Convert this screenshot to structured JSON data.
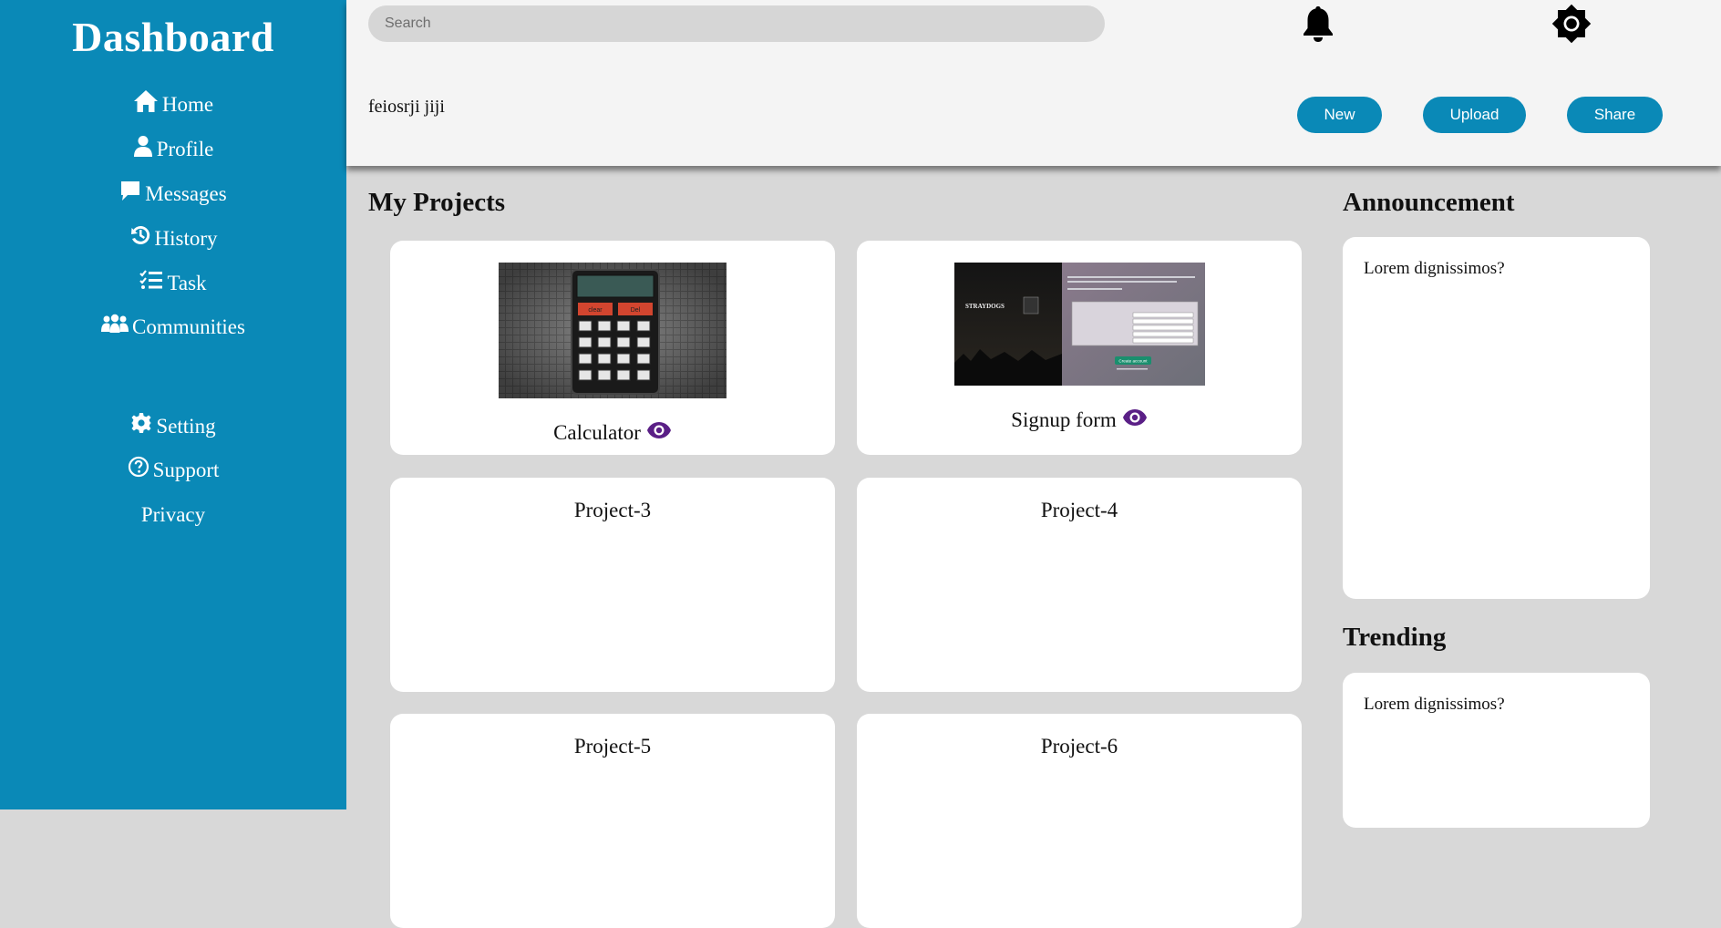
{
  "sidebar": {
    "brand": "Dashboard",
    "items": [
      {
        "label": "Home",
        "icon": "home-icon"
      },
      {
        "label": "Profile",
        "icon": "user-icon"
      },
      {
        "label": "Messages",
        "icon": "message-icon"
      },
      {
        "label": "History",
        "icon": "history-icon"
      },
      {
        "label": "Task",
        "icon": "task-list-icon"
      },
      {
        "label": "Communities",
        "icon": "users-group-icon"
      },
      {
        "label": "Setting",
        "icon": "gear-icon"
      },
      {
        "label": "Support",
        "icon": "question-circle-icon"
      },
      {
        "label": "Privacy",
        "icon": ""
      }
    ]
  },
  "header": {
    "search_placeholder": "Search",
    "username": "feiosrji jiji",
    "buttons": {
      "new": "New",
      "upload": "Upload",
      "share": "Share"
    },
    "icons": [
      "bell-icon",
      "brightness-icon"
    ]
  },
  "main": {
    "title": "My Projects",
    "projects": [
      {
        "name": "Calculator",
        "preview": "calculator"
      },
      {
        "name": "Signup form",
        "preview": "signup"
      },
      {
        "name": "Project-3"
      },
      {
        "name": "Project-4"
      },
      {
        "name": "Project-5"
      },
      {
        "name": "Project-6"
      }
    ],
    "signup_preview": {
      "brand": "STRAYDOGS",
      "button": "Create account"
    },
    "calculator_preview": {
      "clear": "clear",
      "del": "Del"
    }
  },
  "aside": {
    "announcement": {
      "title": "Announcement",
      "text": "Lorem dignissimos?"
    },
    "trending": {
      "title": "Trending",
      "text": "Lorem dignissimos?"
    }
  },
  "colors": {
    "primary": "#0a89b7",
    "eye": "#5a1f86",
    "background": "#d8d8d8",
    "header": "#f4f4f4"
  }
}
